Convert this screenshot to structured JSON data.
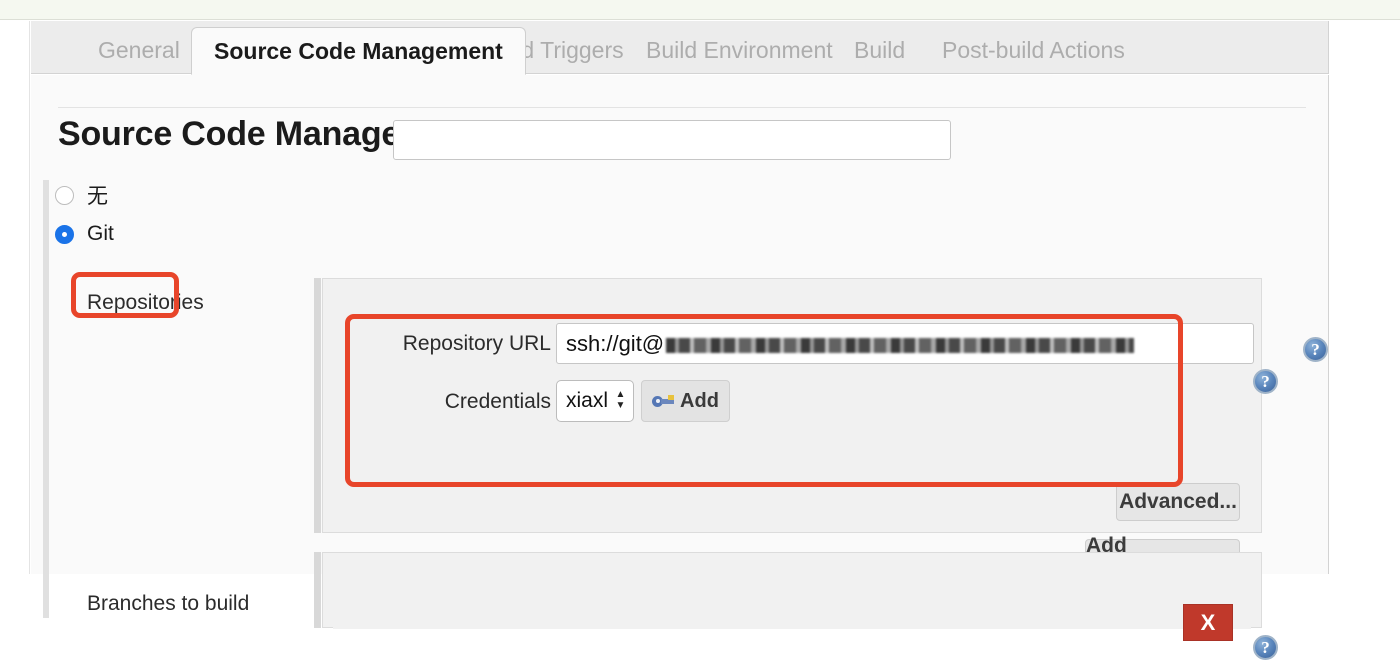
{
  "tabs": [
    {
      "label": "General",
      "active": false
    },
    {
      "label": "Source Code Management",
      "active": true
    },
    {
      "label": "Build Triggers",
      "active": false
    },
    {
      "label": "Build Environment",
      "active": false
    },
    {
      "label": "Build",
      "active": false
    },
    {
      "label": "Post-build Actions",
      "active": false
    }
  ],
  "section": {
    "title": "Source Code Management",
    "scm_options": [
      {
        "label": "无",
        "selected": false
      },
      {
        "label": "Git",
        "selected": true
      }
    ]
  },
  "repositories": {
    "label": "Repositories",
    "repository_url": {
      "label": "Repository URL",
      "value_visible_prefix": "ssh://git@",
      "value_redacted": true
    },
    "credentials": {
      "label": "Credentials",
      "selected": "xiaxl",
      "add_button": "Add",
      "add_button_icon": "key-icon"
    },
    "advanced_button": "Advanced...",
    "add_repository_button": "Add Repository"
  },
  "branches": {
    "label": "Branches to build",
    "delete_button": "X",
    "branch_value": ""
  },
  "help_icons": {
    "glyph": "?",
    "name": "help-icon"
  },
  "annotations": {
    "git_highlight": "Git radio option highlighted",
    "repository_highlight": "Repository URL and Credentials highlighted"
  },
  "colors": {
    "accent_blue": "#1a73e8",
    "annotation_red": "#e8452a",
    "delete_red": "#c0392b",
    "panel_bg": "#f1f1f1",
    "page_bg": "#fafafa"
  }
}
